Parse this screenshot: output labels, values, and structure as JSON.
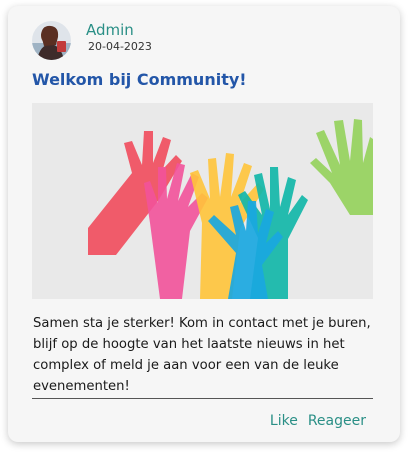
{
  "post": {
    "author": "Admin",
    "date": "20-04-2023",
    "title": "Welkom bij Community!",
    "body": "Samen sta je sterker! Kom in contact met je buren, blijf op de hoogte van het laatste nieuws in het complex of meld je aan voor een van de leuke evenementen!"
  },
  "actions": {
    "like_label": "Like",
    "reply_label": "Reageer"
  },
  "colors": {
    "accent": "#2a8f86",
    "title": "#2356a8",
    "card_bg": "#f6f6f6"
  }
}
